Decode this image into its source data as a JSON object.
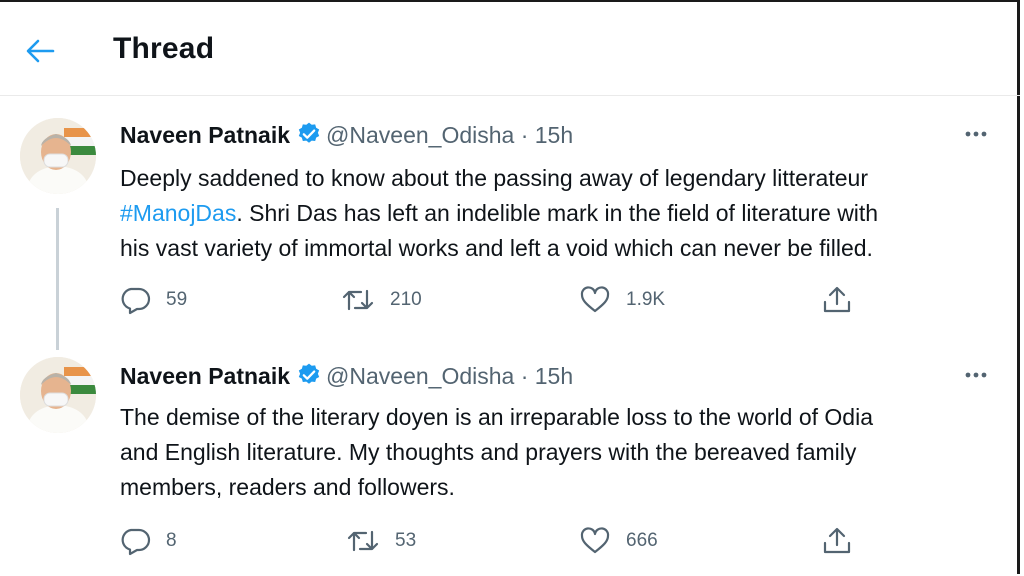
{
  "header": {
    "title": "Thread",
    "back_icon": "arrow-left-icon"
  },
  "colors": {
    "accent": "#1d9bf0",
    "verified": "#1d9bf0",
    "text": "#0f1419",
    "muted": "#536471"
  },
  "tweets": [
    {
      "author": {
        "name": "Naveen Patnaik",
        "handle": "@Naveen_Odisha",
        "time": "· 15h",
        "verified": true
      },
      "lines": [
        "Deeply saddened to know about the passing away of legendary litterateur",
        {
          "hashtag": "#ManojDas",
          "rest": ". Shri Das has left an indelible mark in the field of literature with"
        },
        "his vast variety of immortal works and left a void which can never be filled."
      ],
      "stats": {
        "replies": "59",
        "retweets": "210",
        "likes": "1.9K"
      }
    },
    {
      "author": {
        "name": "Naveen Patnaik",
        "handle": "@Naveen_Odisha",
        "time": "· 15h",
        "verified": true
      },
      "lines": [
        "The demise of the literary doyen is an irreparable loss to the world of Odia",
        "and English literature. My thoughts and prayers with the bereaved family",
        "members, readers and followers."
      ],
      "stats": {
        "replies": "8",
        "retweets": "53",
        "likes": "666"
      }
    }
  ]
}
